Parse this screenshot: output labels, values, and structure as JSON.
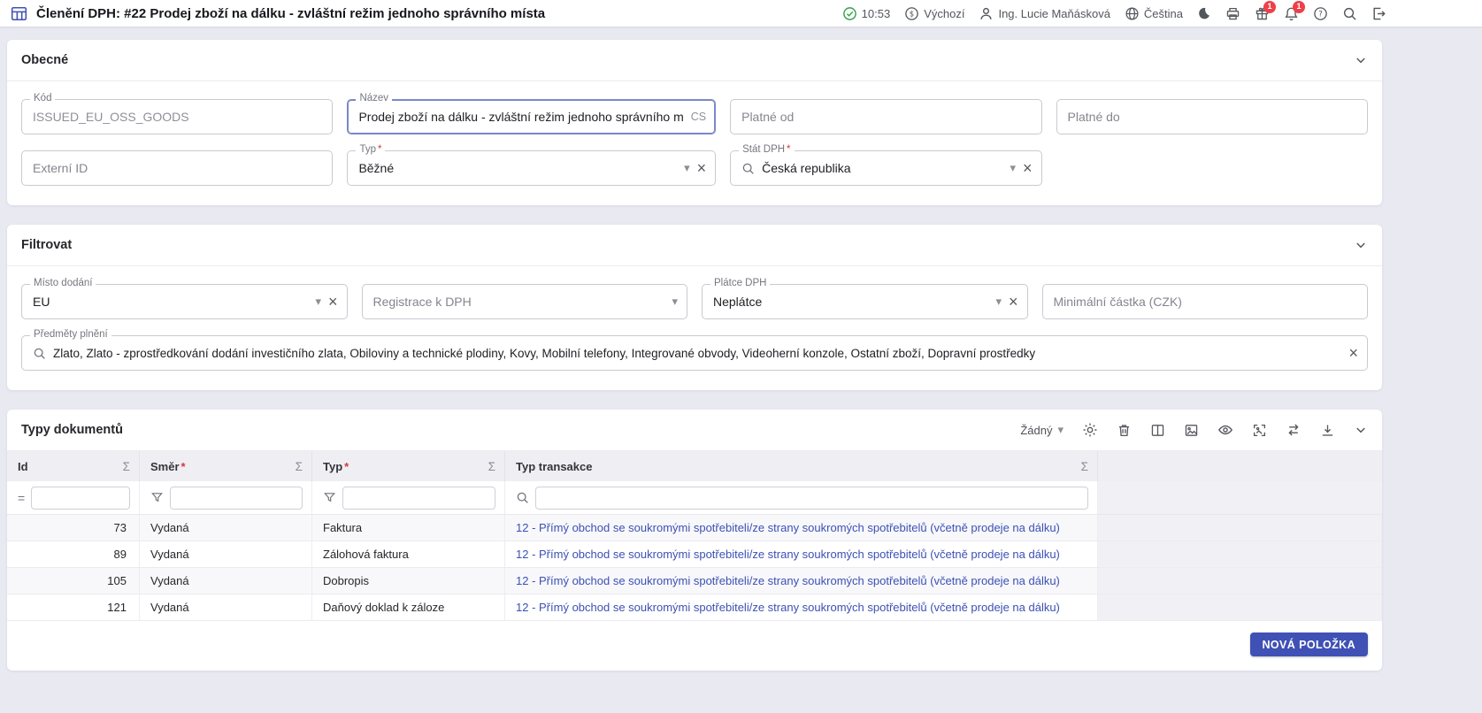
{
  "required_mark": "*",
  "glyphs": {
    "caret": "▾",
    "clear": "×",
    "sigma": "Σ"
  },
  "colors": {
    "accent": "#3f51b5",
    "link": "#3c50b4",
    "badge": "#ef4048",
    "success": "#34a04a",
    "background": "#e9e9f2"
  },
  "icons": {
    "app": "table-grid",
    "status": "check-circle",
    "profile": "dollar-circle",
    "user": "person",
    "language": "globe",
    "theme": "crescent-moon",
    "print": "printer",
    "gifts": "gift",
    "notifications": "bell",
    "help": "question-circle",
    "search": "magnifier",
    "logout": "exit-arrow",
    "toolbar": [
      "gear",
      "trash",
      "view-columns",
      "image",
      "eye",
      "wallpaper",
      "swap-horizontal",
      "download",
      "chevron-down"
    ],
    "filter": "funnel",
    "aggregate": "sigma"
  },
  "topbar": {
    "title": "Členění DPH: #22 Prodej zboží na dálku - zvláštní režim jednoho správního místa",
    "time": "10:53",
    "profile_label": "Výchozí",
    "user_name": "Ing. Lucie Maňásková",
    "language_label": "Čeština",
    "gifts_badge": "1",
    "notifications_badge": "1"
  },
  "general_section": {
    "title": "Obecné",
    "kod": {
      "label": "Kód",
      "value": "ISSUED_EU_OSS_GOODS"
    },
    "nazev": {
      "label": "Název",
      "value": "Prodej zboží na dálku - zvláštní režim jednoho správního m",
      "lang_suffix": "CS"
    },
    "platne_od": {
      "label": "Platné od",
      "value": ""
    },
    "platne_do": {
      "label": "Platné do",
      "value": ""
    },
    "externi_id": {
      "label": "Externí ID",
      "value": ""
    },
    "typ": {
      "label": "Typ",
      "value": "Běžné"
    },
    "stat_dph": {
      "label": "Stát DPH",
      "value": "Česká republika"
    }
  },
  "filter_section": {
    "title": "Filtrovat",
    "misto_dodani": {
      "label": "Místo dodání",
      "value": "EU"
    },
    "registrace_k_dph": {
      "label": "Registrace k DPH",
      "value": ""
    },
    "platce_dph": {
      "label": "Plátce DPH",
      "value": "Neplátce"
    },
    "minimalni_castka": {
      "label": "Minimální částka (CZK)",
      "value": ""
    },
    "predmety_plneni": {
      "label": "Předměty plnění",
      "value": "Zlato, Zlato - zprostředkování dodání investičního zlata, Obiloviny a technické plodiny, Kovy, Mobilní telefony, Integrované obvody, Videoherní konzole, Ostatní zboží, Dopravní prostředky"
    }
  },
  "documents_section": {
    "title": "Typy dokumentů",
    "group_dropdown": "Žádný",
    "id_filter_prefix": "=",
    "columns": {
      "id": "Id",
      "smer": "Směr",
      "typ": "Typ",
      "typ_transakce": "Typ transakce"
    },
    "rows": [
      {
        "id": "73",
        "smer": "Vydaná",
        "typ": "Faktura",
        "typ_transakce": "12 - Přímý obchod se soukromými spotřebiteli/ze strany soukromých spotřebitelů (včetně prodeje na dálku)"
      },
      {
        "id": "89",
        "smer": "Vydaná",
        "typ": "Zálohová faktura",
        "typ_transakce": "12 - Přímý obchod se soukromými spotřebiteli/ze strany soukromých spotřebitelů (včetně prodeje na dálku)"
      },
      {
        "id": "105",
        "smer": "Vydaná",
        "typ": "Dobropis",
        "typ_transakce": "12 - Přímý obchod se soukromými spotřebiteli/ze strany soukromých spotřebitelů (včetně prodeje na dálku)"
      },
      {
        "id": "121",
        "smer": "Vydaná",
        "typ": "Daňový doklad k záloze",
        "typ_transakce": "12 - Přímý obchod se soukromými spotřebiteli/ze strany soukromých spotřebitelů (včetně prodeje na dálku)"
      }
    ],
    "new_item_button": "NOVÁ POLOŽKA"
  }
}
